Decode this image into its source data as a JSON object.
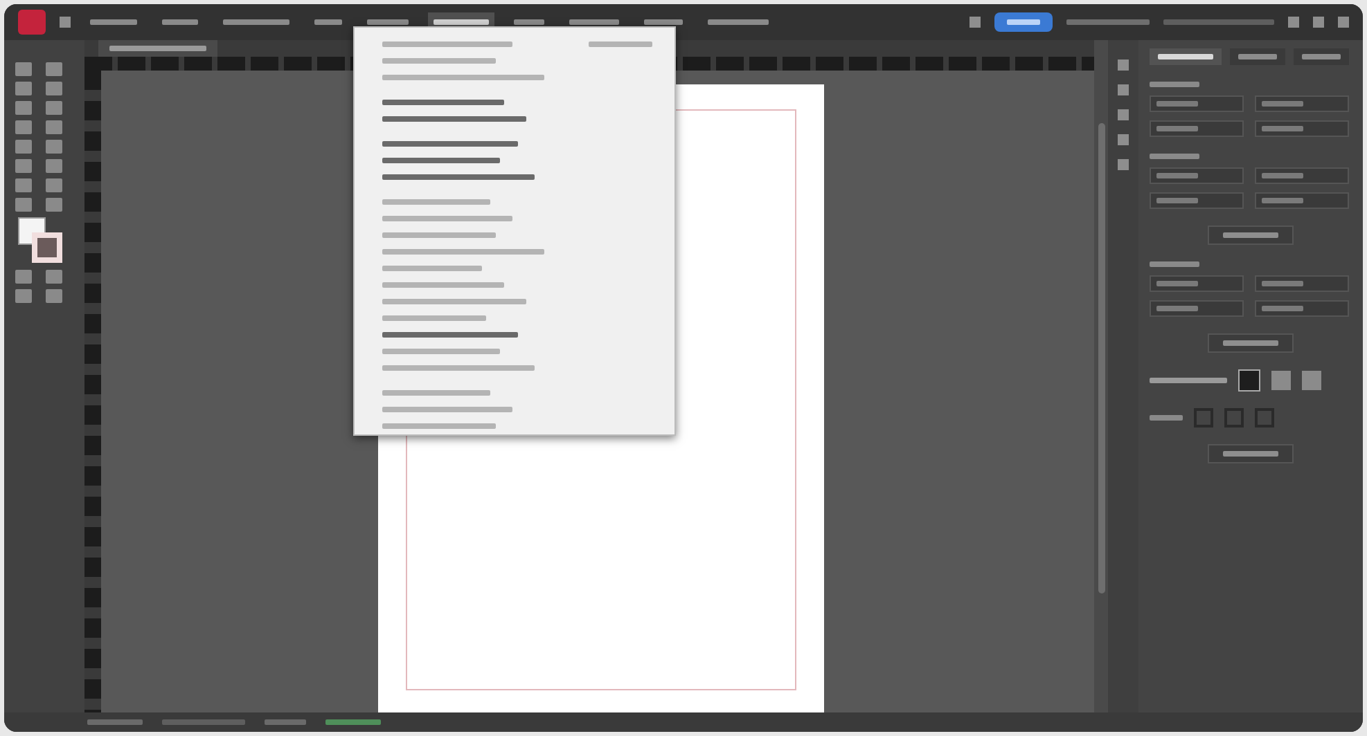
{
  "menu_bar": {
    "items": [
      {
        "kind": "label",
        "selected": false
      },
      {
        "kind": "label",
        "selected": false
      },
      {
        "kind": "label",
        "selected": false
      },
      {
        "kind": "label",
        "selected": false
      },
      {
        "kind": "label",
        "selected": false
      },
      {
        "kind": "label",
        "selected": true
      },
      {
        "kind": "label",
        "selected": false
      },
      {
        "kind": "label",
        "selected": false
      },
      {
        "kind": "label",
        "selected": false
      },
      {
        "kind": "label",
        "selected": false
      }
    ]
  },
  "dropdown": {
    "items": [
      {
        "kind": "entry",
        "shortcut": true
      },
      {
        "kind": "entry",
        "shortcut": false
      },
      {
        "kind": "entry",
        "shortcut": false
      },
      {
        "kind": "separator"
      },
      {
        "kind": "strong",
        "shortcut": false
      },
      {
        "kind": "strong",
        "shortcut": false
      },
      {
        "kind": "separator"
      },
      {
        "kind": "strong",
        "shortcut": false
      },
      {
        "kind": "strong",
        "shortcut": false
      },
      {
        "kind": "strong",
        "shortcut": false
      },
      {
        "kind": "separator"
      },
      {
        "kind": "entry",
        "shortcut": false
      },
      {
        "kind": "entry",
        "shortcut": false
      },
      {
        "kind": "entry",
        "shortcut": false
      },
      {
        "kind": "entry",
        "shortcut": false
      },
      {
        "kind": "entry",
        "shortcut": false
      },
      {
        "kind": "entry",
        "shortcut": false
      },
      {
        "kind": "entry",
        "shortcut": false
      },
      {
        "kind": "entry",
        "shortcut": false
      },
      {
        "kind": "strong",
        "shortcut": false
      },
      {
        "kind": "entry",
        "shortcut": false
      },
      {
        "kind": "entry",
        "shortcut": false
      },
      {
        "kind": "separator"
      },
      {
        "kind": "entry",
        "shortcut": false
      },
      {
        "kind": "entry",
        "shortcut": false
      },
      {
        "kind": "entry",
        "shortcut": false
      }
    ]
  },
  "panel": {
    "tabs": [
      {
        "selected": true
      },
      {
        "selected": false
      },
      {
        "selected": false
      }
    ],
    "sections": [
      {
        "kind": "fields"
      },
      {
        "kind": "fields"
      },
      {
        "kind": "button"
      },
      {
        "kind": "fields"
      },
      {
        "kind": "button"
      },
      {
        "kind": "swatches"
      },
      {
        "kind": "icons"
      },
      {
        "kind": "button"
      }
    ]
  }
}
